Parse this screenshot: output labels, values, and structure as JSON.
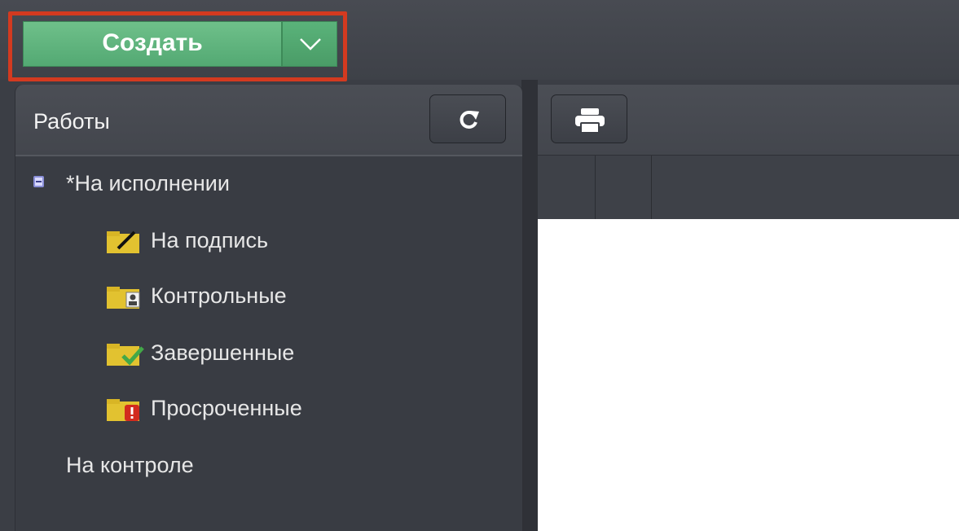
{
  "toolbar": {
    "create_label": "Создать",
    "create_dropdown_icon": "chevron-down-icon",
    "highlight_color": "#d33a20",
    "create_color": "#5fb57e"
  },
  "sidebar": {
    "title": "Работы",
    "refresh_icon": "refresh-icon",
    "groups": [
      {
        "label": "*На исполнении",
        "expanded": true,
        "children": [
          {
            "label": "На подпись",
            "icon": "folder-sign-icon"
          },
          {
            "label": "Контрольные",
            "icon": "folder-user-icon"
          },
          {
            "label": "Завершенные",
            "icon": "folder-check-icon"
          },
          {
            "label": "Просроченные",
            "icon": "folder-alert-icon"
          }
        ]
      },
      {
        "label": "На контроле",
        "expanded": false,
        "children": []
      }
    ]
  },
  "content": {
    "print_icon": "printer-icon",
    "columns": [
      "",
      "",
      ""
    ]
  }
}
